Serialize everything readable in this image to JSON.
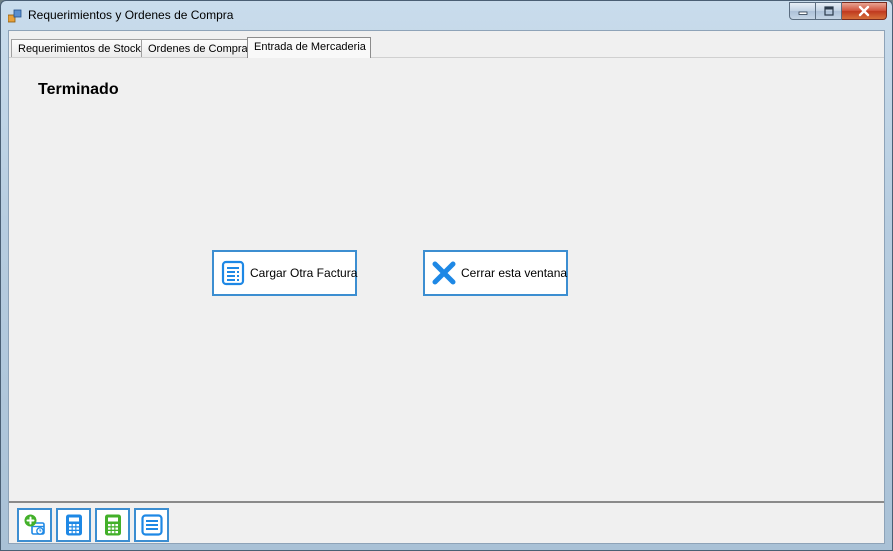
{
  "window": {
    "title": "Requerimientos y Ordenes de Compra"
  },
  "tabs": [
    {
      "label": "Requerimientos de Stock",
      "active": false
    },
    {
      "label": "Ordenes de Compra",
      "active": false
    },
    {
      "label": "Entrada de Mercaderia",
      "active": true
    }
  ],
  "page": {
    "status": "Terminado",
    "buttons": {
      "load_invoice": {
        "label": "Cargar Otra Factura",
        "icon": "invoice-icon"
      },
      "close_window": {
        "label": "Cerrar esta ventana",
        "icon": "close-x-icon"
      }
    }
  },
  "toolbar": {
    "items": [
      {
        "icon": "add-schedule-icon"
      },
      {
        "icon": "calculator-blue-icon"
      },
      {
        "icon": "calculator-green-icon"
      },
      {
        "icon": "list-icon"
      }
    ]
  },
  "colors": {
    "accent": "#3c8ed1",
    "icon_blue": "#1e88e5",
    "icon_green": "#43b02a",
    "close_red": "#c0391f"
  }
}
